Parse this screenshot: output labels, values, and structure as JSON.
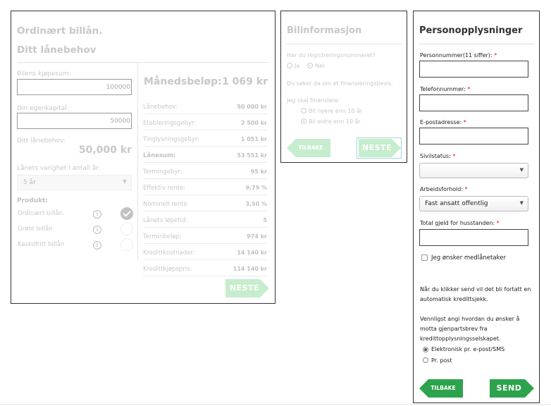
{
  "loan": {
    "title": "Ordinært billån.",
    "subtitle": "Ditt lånebehov",
    "price_label": "Bilens kjøpesum:",
    "price_value": "100000",
    "equity_label": "Din egenkapital:",
    "equity_value": "50000",
    "need_label": "Ditt lånebehov:",
    "need_value": "50,000 kr",
    "duration_label": "Lånets varighet i antall år:",
    "duration_value": "5 år",
    "product_label": "Produkt:",
    "products": [
      {
        "label": "Ordinært billån.",
        "selected": true
      },
      {
        "label": "Grønt billån",
        "selected": false
      },
      {
        "label": "Kaskofritt billån",
        "selected": false
      }
    ],
    "info_glyph": "i",
    "monthly_label": "Månedsbeløp:",
    "monthly_value": "1 069 kr",
    "rows": [
      {
        "k": "Lånebehov:",
        "v": "50 000 kr"
      },
      {
        "k": "Etableringsgebyr:",
        "v": "2 500 kr"
      },
      {
        "k": "Tinglysningsgebyr:",
        "v": "1 051 kr"
      },
      {
        "k": "Lånesum:",
        "v": "53 551 kr"
      },
      {
        "k": "Termingebyr:",
        "v": "95 kr"
      },
      {
        "k": "Effektiv rente:",
        "v": "9,79 %"
      },
      {
        "k": "Nominell rente",
        "v": "3,50 %"
      },
      {
        "k": "Lånets løpetid:",
        "v": "5"
      },
      {
        "k": "Terminbeløp:",
        "v": "974 kr"
      },
      {
        "k": "Kredittkostnader:",
        "v": "14 140 kr"
      },
      {
        "k": "Kredittkjøpspris:",
        "v": "114 140 kr"
      }
    ],
    "next_label": "NESTE"
  },
  "car": {
    "title": "Bilinformasjon",
    "reg_question": "Har du registreringsnummeret?",
    "reg_yes": "Ja",
    "reg_no": "Nei",
    "search_note": "Du søker da om et finansieringsbevis.",
    "finance_question": "Jeg skal finansiere:",
    "opt_newer": "Bil nyere enn 10 år",
    "opt_older": "Bil eldre enn 10 år",
    "back_label": "TILBAKE",
    "next_label": "NESTE"
  },
  "person": {
    "title": "Personopplysninger",
    "ssn_label": "Personnummer(11 siffer):",
    "phone_label": "Telefonnummer:",
    "email_label": "E-postadresse:",
    "civil_label": "Sivilstatus:",
    "civil_value": "",
    "employment_label": "Arbeidsforhold:",
    "employment_value": "Fast ansatt offentlig",
    "debt_label": "Total gjeld for husstanden:",
    "req_mark": "*",
    "coapplicant_label": "Jeg ønsker medlånetaker",
    "credit_note": "Når du klikker send vil det bli fortatt en automatisk kredittsjekk.",
    "copy_note": "Vennligst angi hvordan du ønsker å motta gjenpartsbrev fra kredittopplysningsselskapet.",
    "opt_electronic": "Elektronisk pr. e-post/SMS",
    "opt_post": "Pr. post",
    "back_label": "TILBAKE",
    "send_label": "SEND"
  },
  "colors": {
    "accent": "#2ea34d",
    "accent_disabled": "#c6edcd",
    "required": "#e00000"
  }
}
